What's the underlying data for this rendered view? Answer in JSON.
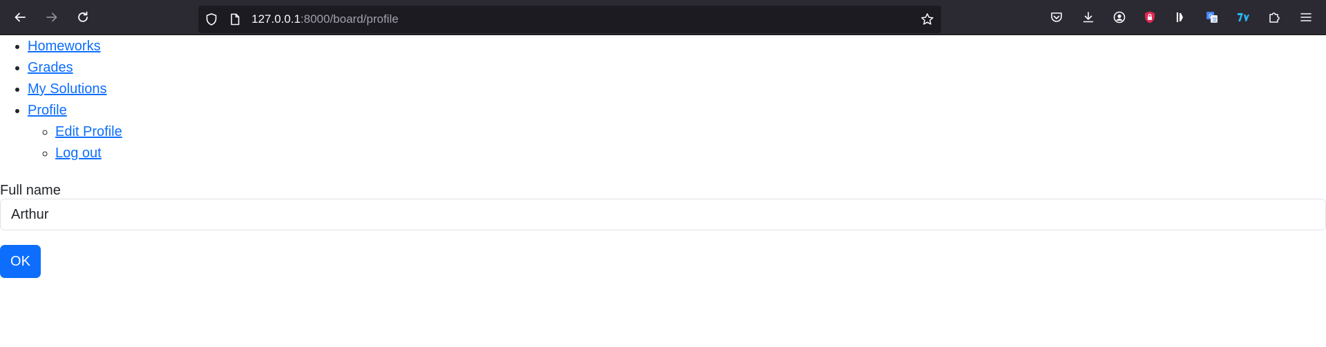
{
  "browser": {
    "url_host": "127.0.0.1",
    "url_path": ":8000/board/profile",
    "icons": {
      "back": "arrow-left-icon",
      "forward": "arrow-right-icon",
      "reload": "reload-icon",
      "shield": "tracking-shield-icon",
      "page": "page-icon",
      "bookmark": "star-icon",
      "pocket": "pocket-icon",
      "downloads": "download-icon",
      "account": "account-icon",
      "extensions": "puzzle-icon",
      "menu": "hamburger-menu-icon"
    }
  },
  "nav": {
    "items": [
      {
        "label": "Homeworks"
      },
      {
        "label": "Grades"
      },
      {
        "label": "My Solutions"
      },
      {
        "label": "Profile"
      }
    ],
    "profile_sub": [
      {
        "label": "Edit Profile"
      },
      {
        "label": "Log out"
      }
    ]
  },
  "form": {
    "full_name_label": "Full name",
    "full_name_value": "Arthur",
    "submit_label": "OK"
  },
  "colors": {
    "link": "#0d6efd",
    "button": "#0d6efd",
    "toolbar": "#2b2a33",
    "urlbar": "#1c1b22"
  }
}
